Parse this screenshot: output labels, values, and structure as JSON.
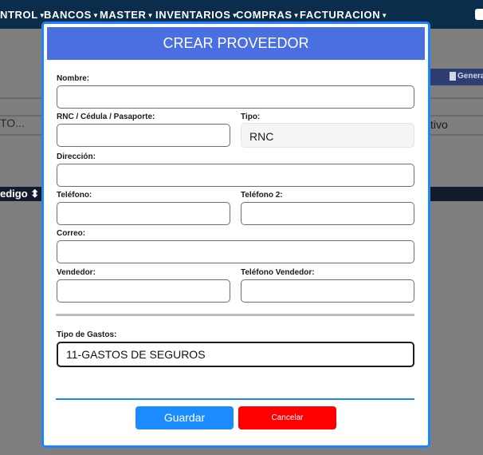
{
  "nav": {
    "items": [
      {
        "label": "NTROL"
      },
      {
        "label": "BANCOS"
      },
      {
        "label": "MASTER"
      },
      {
        "label": "INVENTARIOS"
      },
      {
        "label": "COMPRAS"
      },
      {
        "label": "FACTURACION"
      }
    ]
  },
  "background": {
    "search_placeholder": "TO...",
    "filter_value": "tivo",
    "generate_button": "Genera",
    "column_header": "edigo"
  },
  "modal": {
    "title": "CREAR PROVEEDOR",
    "fields": {
      "nombre": {
        "label": "Nombre:",
        "value": ""
      },
      "rnc": {
        "label": "RNC / Cédula / Pasaporte:",
        "value": ""
      },
      "tipo": {
        "label": "Tipo:",
        "value": "RNC"
      },
      "direccion": {
        "label": "Dirección:",
        "value": ""
      },
      "telefono": {
        "label": "Teléfono:",
        "value": ""
      },
      "telefono2": {
        "label": "Teléfono 2:",
        "value": ""
      },
      "correo": {
        "label": "Correo:",
        "value": ""
      },
      "vendedor": {
        "label": "Vendedor:",
        "value": ""
      },
      "telefono_vendedor": {
        "label": "Teléfono Vendedor:",
        "value": ""
      },
      "tipo_gastos": {
        "label": "Tipo de Gastos:",
        "value": "11-GASTOS DE SEGUROS"
      }
    },
    "buttons": {
      "save": "Guardar",
      "cancel": "Cancelar"
    }
  },
  "colors": {
    "nav_bg": "#0b2d4c",
    "modal_header": "#4a6fe0",
    "modal_border": "#1a85ff",
    "save_button": "#1a8cff",
    "cancel_button": "#ff0000"
  }
}
